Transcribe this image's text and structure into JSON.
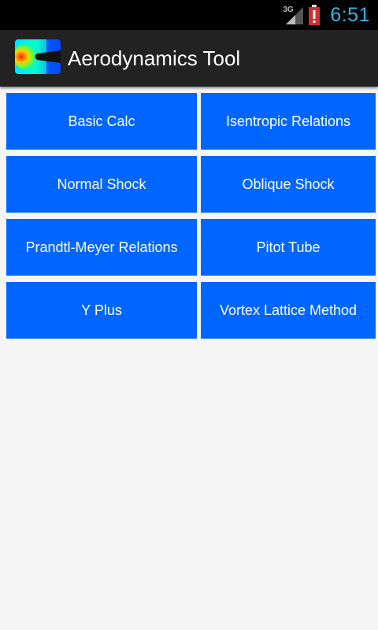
{
  "status_bar": {
    "network_type": "3G",
    "time": "6:51",
    "icons": [
      "signal-icon",
      "battery-alert-icon"
    ]
  },
  "action_bar": {
    "app_icon": "airfoil-flow-contour-icon",
    "title": "Aerodynamics Tool"
  },
  "menu": {
    "items": [
      {
        "label": "Basic Calc"
      },
      {
        "label": "Isentropic Relations"
      },
      {
        "label": "Normal Shock"
      },
      {
        "label": "Oblique Shock"
      },
      {
        "label": "Prandtl-Meyer Relations"
      },
      {
        "label": "Pitot Tube"
      },
      {
        "label": "Y Plus"
      },
      {
        "label": "Vortex Lattice Method"
      }
    ]
  },
  "colors": {
    "tile_background": "#0066ff",
    "action_bar": "#222222",
    "status_bar": "#000000",
    "clock": "#33b5e5",
    "battery_alert": "#d32f2f",
    "page_background": "#f5f5f5"
  }
}
